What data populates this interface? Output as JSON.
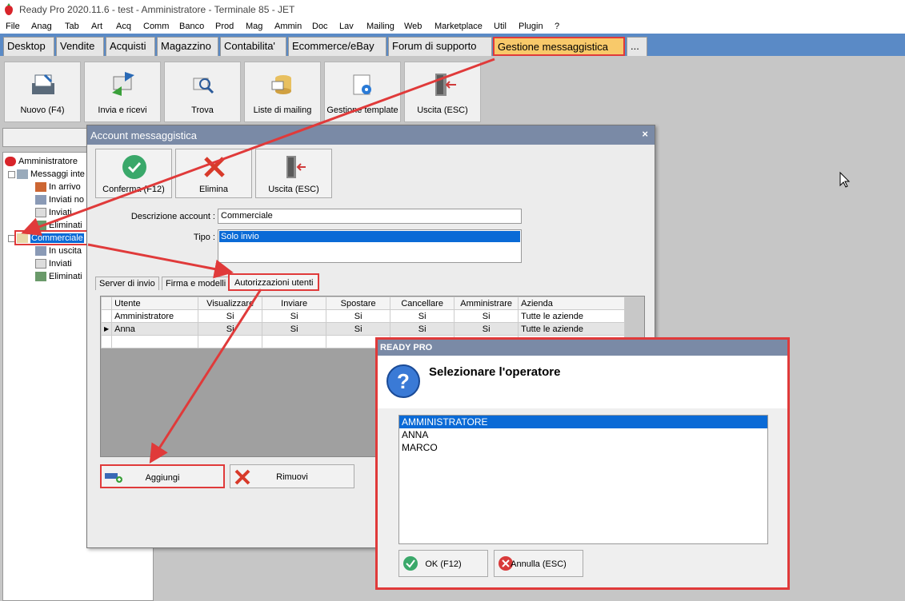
{
  "window": {
    "title": "Ready Pro 2020.11.6 - test - Amministratore - Terminale 85 - JET"
  },
  "menu": [
    "File",
    "Anag",
    "Tab",
    "Art",
    "Acq",
    "Comm",
    "Banco",
    "Prod",
    "Mag",
    "Ammin",
    "Doc",
    "Lav",
    "Mailing",
    "Web",
    "Marketplace",
    "Util",
    "Plugin",
    "?"
  ],
  "tabs": [
    "Desktop",
    "Vendite",
    "Acquisti",
    "Magazzino",
    "Contabilita'",
    "Ecommerce/eBay",
    "Forum di supporto",
    "Gestione messaggistica",
    "..."
  ],
  "toolbar": {
    "new": "Nuovo (F4)",
    "sendrecv": "Invia e ricevi",
    "find": "Trova",
    "lists": "Liste di mailing",
    "templates": "Gestione template",
    "exit": "Uscita (ESC)"
  },
  "tree": {
    "root": "Amministratore",
    "messages": "Messaggi inte",
    "inbox": "In arrivo",
    "sentnot": "Inviati no",
    "sent": "Inviati",
    "deleted": "Eliminati",
    "account": "Commerciale",
    "outbox": "In uscita",
    "sent2": "Inviati",
    "deleted2": "Eliminati"
  },
  "dialog": {
    "title": "Account messaggistica",
    "close": "×",
    "confirm": "Conferma (F12)",
    "delete": "Elimina",
    "exit": "Uscita (ESC)",
    "desc_label": "Descrizione account :",
    "desc_value": "Commerciale",
    "type_label": "Tipo :",
    "type_value": "Solo invio",
    "subtabs": [
      "Server di invio",
      "Firma e modelli",
      "Autorizzazioni utenti"
    ],
    "columns": [
      "Utente",
      "Visualizzare",
      "Inviare",
      "Spostare",
      "Cancellare",
      "Amministrare",
      "Azienda"
    ],
    "rows": [
      [
        "Amministratore",
        "Si",
        "Si",
        "Si",
        "Si",
        "Si",
        "Tutte le aziende"
      ],
      [
        "Anna",
        "Si",
        "Si",
        "Si",
        "Si",
        "Si",
        "Tutte le aziende"
      ]
    ],
    "add": "Aggiungi",
    "remove": "Rimuovi"
  },
  "picker": {
    "title": "READY PRO",
    "message": "Selezionare l'operatore",
    "options": [
      "AMMINISTRATORE",
      "ANNA",
      "MARCO"
    ],
    "selected": "AMMINISTRATORE",
    "ok": "OK (F12)",
    "cancel": "Annulla (ESC)"
  },
  "colors": {
    "accent": "#e03a3a",
    "tabbar": "#5a8ac6",
    "selection": "#0a6ad6",
    "active_tab": "#f8c96a"
  }
}
